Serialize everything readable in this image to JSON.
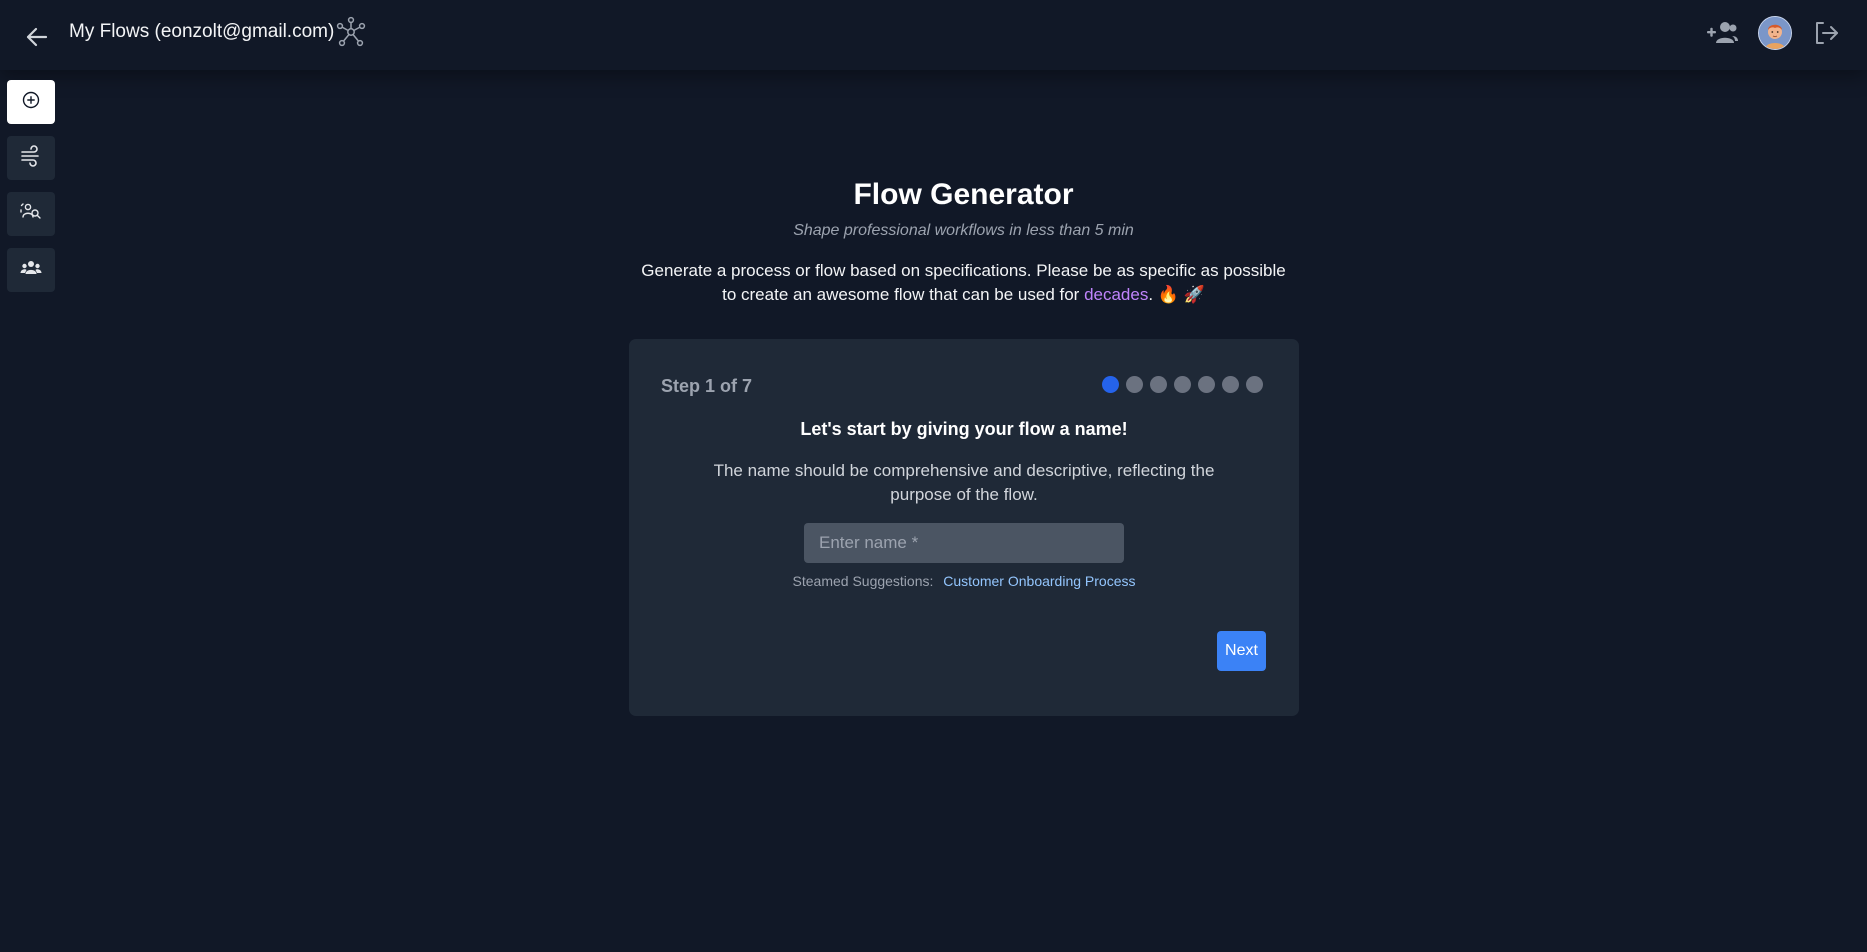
{
  "header": {
    "title": "My Flows (eonzolt@gmail.com)",
    "icons": {
      "back": "arrow-left-icon",
      "logo": "network-graph-icon",
      "add_user": "user-plus-icon",
      "avatar": "user-avatar",
      "logout": "logout-icon"
    }
  },
  "sidebar": {
    "items": [
      {
        "icon": "plus-circle-icon",
        "active": true
      },
      {
        "icon": "wind-icon",
        "active": false
      },
      {
        "icon": "user-search-icon",
        "active": false
      },
      {
        "icon": "team-icon",
        "active": false
      }
    ]
  },
  "main": {
    "title": "Flow Generator",
    "subtitle": "Shape professional workflows in less than 5 min",
    "description_before": "Generate a process or flow based on specifications. Please be as specific as possible to create an awesome flow that can be used for ",
    "description_highlight": "decades",
    "description_after": ". 🔥 🚀"
  },
  "wizard": {
    "step_label": "Step 1 of 7",
    "current_step": 1,
    "total_steps": 7,
    "heading": "Let's start by giving your flow a name!",
    "description": "The name should be comprehensive and descriptive, reflecting the purpose of the flow.",
    "input": {
      "placeholder": "Enter name *",
      "value": ""
    },
    "suggestions_label": "Steamed Suggestions:",
    "suggestion": "Customer Onboarding Process",
    "next_label": "Next"
  },
  "colors": {
    "background": "#111827",
    "card": "#1f2937",
    "accent": "#3b82f6",
    "active_dot": "#2563eb",
    "inactive_dot": "#6b7280",
    "highlight": "#c084fc",
    "link": "#93c5fd"
  }
}
